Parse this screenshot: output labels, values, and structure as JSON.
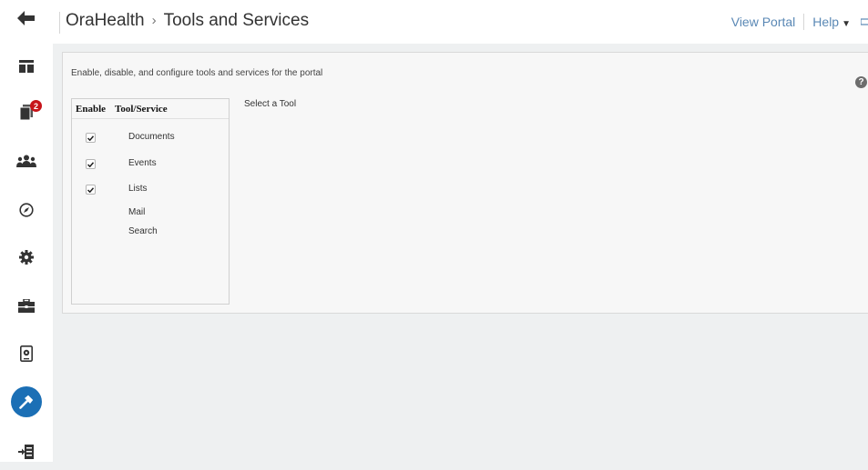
{
  "header": {
    "app_name": "OraHealth",
    "page_title": "Tools and Services",
    "view_portal": "View Portal",
    "help": "Help"
  },
  "rail": {
    "badge_count": "2",
    "items": [
      {
        "icon": "back-arrow-icon"
      },
      {
        "icon": "page-layout-icon"
      },
      {
        "icon": "documents-icon"
      },
      {
        "icon": "people-icon"
      },
      {
        "icon": "compass-icon"
      },
      {
        "icon": "gear-icon"
      },
      {
        "icon": "toolbox-icon"
      },
      {
        "icon": "device-settings-icon"
      },
      {
        "icon": "hammer-icon",
        "active": true
      },
      {
        "icon": "sign-out-icon"
      }
    ]
  },
  "main": {
    "intro": "Enable, disable, and configure tools and services for the portal",
    "table": {
      "col_enable": "Enable",
      "col_tool": "Tool/Service",
      "rows": [
        {
          "label": "Documents",
          "enabled": true
        },
        {
          "label": "Events",
          "enabled": true
        },
        {
          "label": "Lists",
          "enabled": true
        },
        {
          "label": "Mail",
          "enabled": false
        },
        {
          "label": "Search",
          "enabled": false
        }
      ]
    },
    "detail_prompt": "Select a Tool"
  },
  "colors": {
    "accent": "#1b6fb5",
    "link": "#5a88b5",
    "badge": "#c7141a"
  }
}
